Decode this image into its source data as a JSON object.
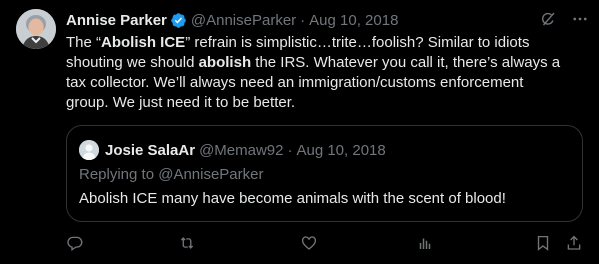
{
  "author": {
    "name": "Annise Parker",
    "handle": "@AnniseParker",
    "separator": "·",
    "date": "Aug 10, 2018"
  },
  "tweet": {
    "l1a": "The “",
    "l1b": "Abolish ICE",
    "l1c": "” refrain is simplistic…trite…foolish? Similar to idiots",
    "l2a": "shouting we should ",
    "l2b": "abolish",
    "l2c": " the IRS. Whatever you call it, there’s always a",
    "l3": "tax collector. We’ll always need an immigration/customs enforcement",
    "l4": "group. We just need it to be better."
  },
  "quote": {
    "name": "Josie SalaAr",
    "handle": "@Memaw92",
    "separator": "·",
    "date": "Aug 10, 2018",
    "replying": "Replying to @AnniseParker",
    "text": "Abolish ICE many have become animals with the scent of blood!"
  },
  "colors": {
    "background": "#000000",
    "text": "#e7e9ea",
    "muted": "#71767b",
    "verified": "#1d9bf0",
    "border": "#2f3336"
  },
  "icons": [
    "verified-badge-icon",
    "grok-icon",
    "more-icon",
    "reply-icon",
    "retweet-icon",
    "like-icon",
    "views-icon",
    "bookmark-icon",
    "share-icon"
  ]
}
